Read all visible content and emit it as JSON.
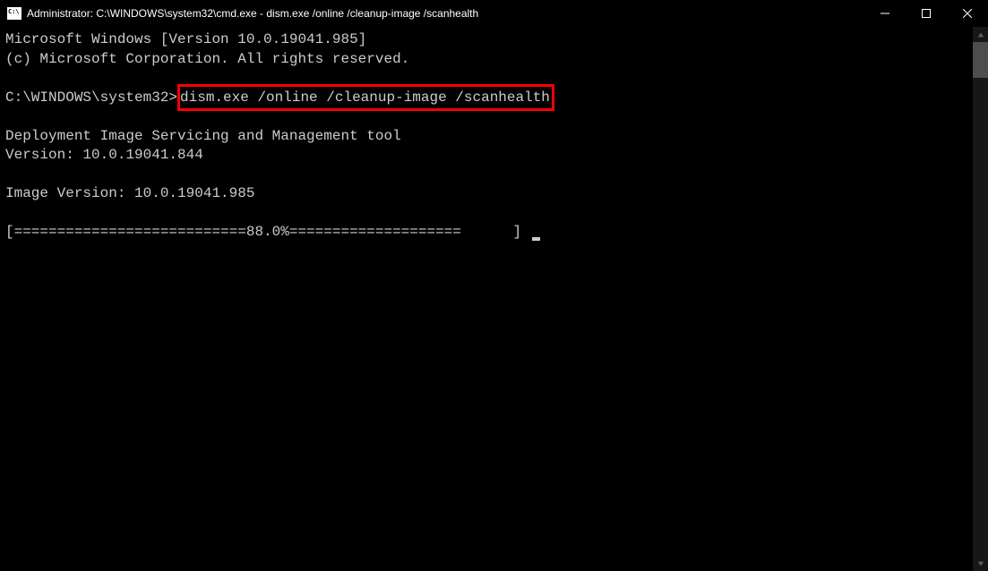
{
  "window": {
    "title": "Administrator: C:\\WINDOWS\\system32\\cmd.exe - dism.exe  /online /cleanup-image /scanhealth"
  },
  "terminal": {
    "line1": "Microsoft Windows [Version 10.0.19041.985]",
    "line2": "(c) Microsoft Corporation. All rights reserved.",
    "blank1": "",
    "prompt_prefix": "C:\\WINDOWS\\system32>",
    "command_highlighted": "dism.exe /online /cleanup-image /scanhealth",
    "blank2": "",
    "tool_name": "Deployment Image Servicing and Management tool",
    "tool_version": "Version: 10.0.19041.844",
    "blank3": "",
    "image_version": "Image Version: 10.0.19041.985",
    "blank4": "",
    "progress_bar": "[===========================88.0%====================      ] "
  }
}
